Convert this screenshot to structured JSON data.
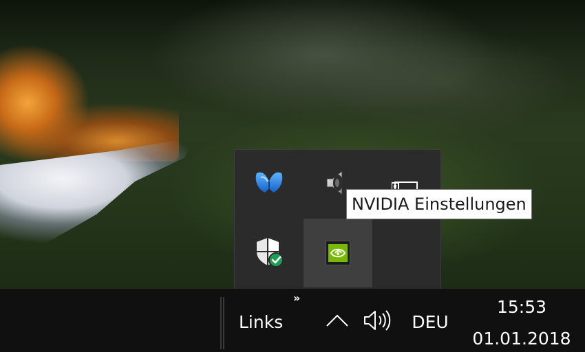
{
  "tooltip": {
    "text": "NVIDIA Einstellungen"
  },
  "tray_flyout": {
    "icons": [
      {
        "name": "malwarebytes-icon"
      },
      {
        "name": "speaker-icon"
      },
      {
        "name": "network-icon"
      },
      {
        "name": "windows-defender-icon"
      },
      {
        "name": "nvidia-icon",
        "hovered": true
      }
    ]
  },
  "taskbar": {
    "toolbar_label": "Links",
    "toolbar_expand_glyph": "»",
    "show_hidden_icons": "chevron-up-icon",
    "volume": "volume-icon",
    "language": "DEU",
    "time": "15:53",
    "date": "01.01.2018"
  },
  "colors": {
    "taskbar": "#101010",
    "flyout": "#2b2b2b",
    "flyout_hover": "#3f3f3f",
    "nvidia_green": "#76b900",
    "defender_check": "#1f9d55",
    "malwarebytes_blue": "#1e88e5"
  }
}
